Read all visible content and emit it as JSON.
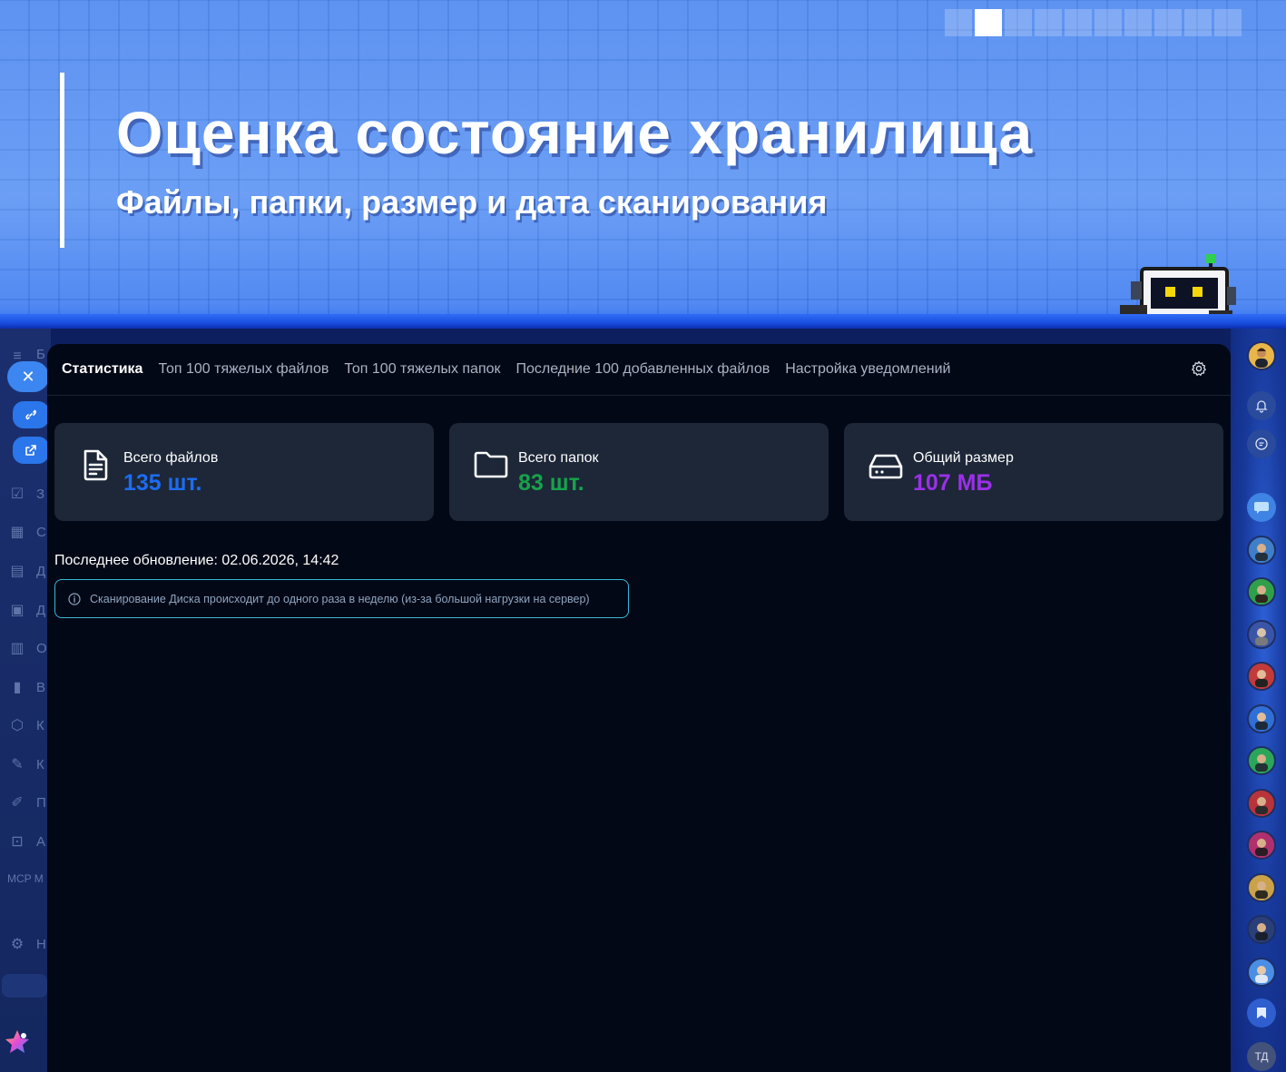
{
  "banner": {
    "title": "Оценка состояние хранилища",
    "subtitle": "Файлы, папки, размер и дата сканирования",
    "progress": {
      "total": 10,
      "active_index": 1
    }
  },
  "tabs": [
    {
      "label": "Статистика",
      "active": true
    },
    {
      "label": "Топ 100 тяжелых файлов",
      "active": false
    },
    {
      "label": "Топ 100 тяжелых папок",
      "active": false
    },
    {
      "label": "Последние 100 добавленных файлов",
      "active": false
    },
    {
      "label": "Настройка уведомлений",
      "active": false
    }
  ],
  "stats": {
    "files": {
      "label": "Всего файлов",
      "value": "135 шт.",
      "color": "#1d6cf0",
      "icon": "file-icon"
    },
    "folders": {
      "label": "Всего папок",
      "value": "83 шт.",
      "color": "#16a34a",
      "icon": "folder-icon"
    },
    "size": {
      "label": "Общий размер",
      "value": "107 МБ",
      "color": "#9b30e8",
      "icon": "hard-drive-icon"
    }
  },
  "last_update": "Последнее обновление: 02.06.2026, 14:42",
  "info_notice": "Сканирование Диска происходит до одного раза в неделю (из-за большой нагрузки на сервер)",
  "left_sidebar": {
    "letters": [
      "Б",
      "З",
      "С",
      "Д",
      "Д",
      "О",
      "В",
      "К",
      "К",
      "П",
      "А",
      "MCP М",
      "Н"
    ]
  },
  "right_rail": {
    "initials": "ТД"
  },
  "colors": {
    "accent": "#3b86f0",
    "panel_bg": "#030816",
    "card_bg": "#1d2738",
    "info_border": "#37b9d8"
  }
}
